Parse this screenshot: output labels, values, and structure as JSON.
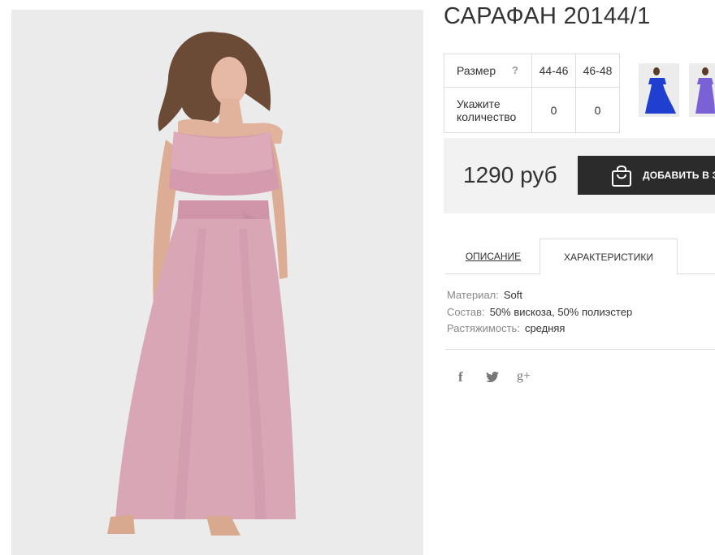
{
  "product": {
    "title": "САРАФАН 20144/1",
    "price": "1290 руб",
    "add_to_cart_label": "ДОБАВИТЬ В З"
  },
  "size_table": {
    "size_label": "Размер",
    "help_mark": "?",
    "qty_label_line1": "Укажите",
    "qty_label_line2": "количество",
    "sizes": [
      "44-46",
      "46-48"
    ],
    "quantities": [
      "0",
      "0"
    ]
  },
  "thumbnails": [
    {
      "name": "thumb-blue-dress",
      "color": "#1f3fcf"
    },
    {
      "name": "thumb-violet-dress",
      "color": "#7a62d6"
    }
  ],
  "tabs": {
    "description": "ОПИСАНИЕ",
    "characteristics": "ХАРАКТЕРИСТИКИ",
    "active": "characteristics"
  },
  "specs": [
    {
      "key": "Материал:",
      "value": "Soft"
    },
    {
      "key": "Состав:",
      "value": "50% вискоза, 50% полиэстер"
    },
    {
      "key": "Растяжимость:",
      "value": "средняя"
    }
  ],
  "social": {
    "facebook": "f",
    "twitter": "twitter-icon",
    "google_plus": "g+"
  },
  "colors": {
    "dress": "#d9a6b6",
    "button": "#2b2b2b",
    "panel": "#f2f2f2"
  }
}
